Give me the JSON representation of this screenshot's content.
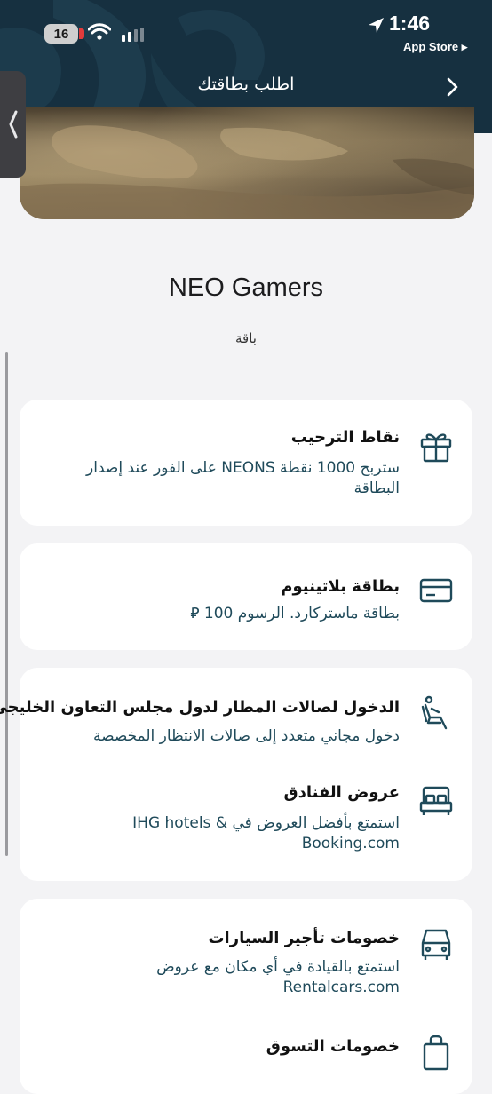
{
  "status_bar": {
    "battery": "16",
    "time": "1:46",
    "back_app": "App Store ▸"
  },
  "nav": {
    "title": "اطلب بطاقتك"
  },
  "product": {
    "name": "NEO Gamers",
    "subtitle": "باقة"
  },
  "colors": {
    "header": "#163040",
    "accent_text": "#1f4a5a",
    "icon": "#1f4a5a"
  },
  "cards": [
    {
      "features": [
        {
          "icon": "gift-icon",
          "title": "نقاط الترحيب",
          "desc": "ستربح 1000 نقطة NEONS على الفور عند إصدار البطاقة"
        }
      ]
    },
    {
      "features": [
        {
          "icon": "credit-card-icon",
          "title": "بطاقة بلاتينيوم",
          "desc": "بطاقة ماستركارد. الرسوم 100 ⃁"
        }
      ]
    },
    {
      "features": [
        {
          "icon": "lounge-seat-icon",
          "title": "الدخول لصالات المطار لدول مجلس التعاون الخليجي",
          "desc": "دخول مجاني متعدد إلى صالات الانتظار المخصصة"
        },
        {
          "icon": "bed-icon",
          "title": "عروض الفنادق",
          "desc": "استمتع بأفضل العروض في IHG hotels & Booking.com"
        }
      ]
    },
    {
      "features": [
        {
          "icon": "car-icon",
          "title": "خصومات تأجير السيارات",
          "desc": "استمتع بالقيادة في أي مكان مع عروض Rentalcars.com"
        },
        {
          "icon": "shopping-bag-icon",
          "title": "خصومات التسوق",
          "desc": ""
        }
      ]
    }
  ]
}
